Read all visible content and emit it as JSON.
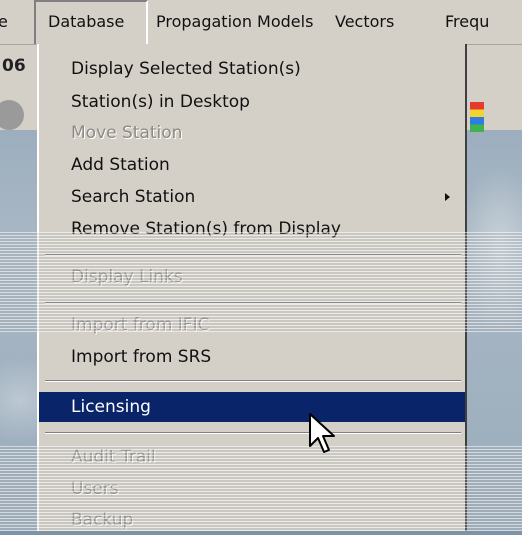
{
  "menubar": {
    "items": [
      {
        "label": "e"
      },
      {
        "label": "Database"
      },
      {
        "label": "Propagation Models"
      },
      {
        "label": "Vectors"
      },
      {
        "label": "Frequ"
      }
    ]
  },
  "toolbar": {
    "partial_text": "06"
  },
  "dropdown": {
    "items": [
      {
        "label": "Display Selected Station(s)",
        "enabled": true
      },
      {
        "label": "Station(s) in Desktop",
        "enabled": true
      },
      {
        "label": "Move Station",
        "enabled": false
      },
      {
        "label": "Add Station",
        "enabled": true
      },
      {
        "label": "Search Station",
        "enabled": true,
        "submenu": true
      },
      {
        "label": "Remove Station(s) from Display",
        "enabled": true
      },
      {
        "label": "Display Links",
        "enabled": false
      },
      {
        "label": "Import from IFIC",
        "enabled": false
      },
      {
        "label": "Import from SRS",
        "enabled": true
      },
      {
        "label": "Licensing",
        "enabled": true,
        "selected": true
      },
      {
        "label": "Audit Trail",
        "enabled": false
      },
      {
        "label": "Users",
        "enabled": false
      },
      {
        "label": "Backup",
        "enabled": false
      }
    ]
  },
  "colors": {
    "menu_face": "#d4d0c8",
    "highlight": "#0a246a",
    "disabled_text": "#8d8a84"
  }
}
